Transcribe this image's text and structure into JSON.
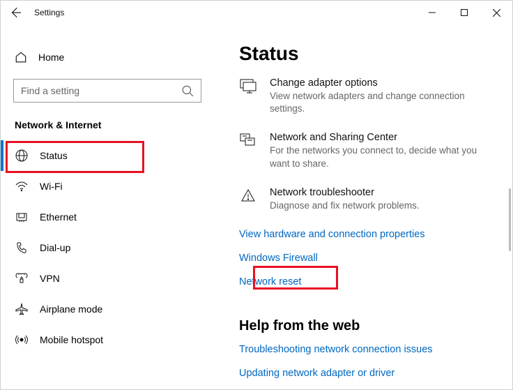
{
  "window": {
    "title": "Settings"
  },
  "sidebar": {
    "home": "Home",
    "search_placeholder": "Find a setting",
    "section": "Network & Internet",
    "items": [
      {
        "label": "Status"
      },
      {
        "label": "Wi-Fi"
      },
      {
        "label": "Ethernet"
      },
      {
        "label": "Dial-up"
      },
      {
        "label": "VPN"
      },
      {
        "label": "Airplane mode"
      },
      {
        "label": "Mobile hotspot"
      }
    ]
  },
  "main": {
    "title": "Status",
    "options": [
      {
        "title": "Change adapter options",
        "desc": "View network adapters and change connection settings."
      },
      {
        "title": "Network and Sharing Center",
        "desc": "For the networks you connect to, decide what you want to share."
      },
      {
        "title": "Network troubleshooter",
        "desc": "Diagnose and fix network problems."
      }
    ],
    "links": {
      "hardware": "View hardware and connection properties",
      "firewall": "Windows Firewall",
      "reset": "Network reset"
    },
    "help_header": "Help from the web",
    "help_links": {
      "troubleshoot": "Troubleshooting network connection issues",
      "update": "Updating network adapter or driver"
    }
  }
}
